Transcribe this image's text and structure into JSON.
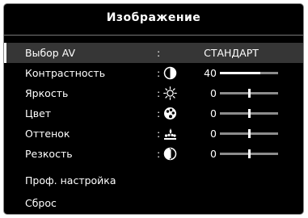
{
  "menu": {
    "title": "Изображение",
    "separator": ":",
    "items": [
      {
        "label": "Выбор AV",
        "value": "СТАНДАРТ"
      },
      {
        "label": "Контрастность",
        "icon": "contrast-icon",
        "value": "40",
        "level": 0.7
      },
      {
        "label": "Яркость",
        "icon": "brightness-icon",
        "value": "0",
        "level": 0.5
      },
      {
        "label": "Цвет",
        "icon": "color-icon",
        "value": "0",
        "level": 0.5
      },
      {
        "label": "Оттенок",
        "icon": "tint-icon",
        "value": "0",
        "level": 0.5
      },
      {
        "label": "Резкость",
        "icon": "sharpness-icon",
        "value": "0",
        "level": 0.5
      },
      {
        "label": "Проф. настройка"
      },
      {
        "label": "Сброс"
      }
    ]
  }
}
